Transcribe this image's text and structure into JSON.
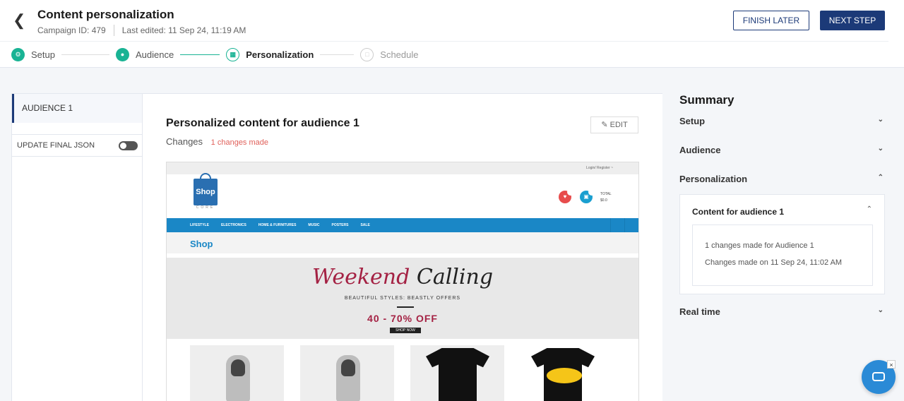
{
  "header": {
    "title": "Content personalization",
    "campaign_id": "Campaign ID: 479",
    "last_edited": "Last edited: 11 Sep 24, 11:19 AM",
    "finish_later": "FINISH LATER",
    "next_step": "NEXT STEP"
  },
  "steps": [
    {
      "label": "Setup",
      "state": "done"
    },
    {
      "label": "Audience",
      "state": "done"
    },
    {
      "label": "Personalization",
      "state": "current"
    },
    {
      "label": "Schedule",
      "state": "pending"
    }
  ],
  "sidebar": {
    "audience": "AUDIENCE 1",
    "update_json": "UPDATE FINAL JSON",
    "update_json_enabled": false
  },
  "content": {
    "title": "Personalized content for audience 1",
    "changes_label": "Changes",
    "changes_count": "1 changes made",
    "edit": "EDIT"
  },
  "preview": {
    "top_links": "Login/ Register ~",
    "logo": "Shop",
    "logo_sub": "CORE",
    "total_label": "TOTAL",
    "total_value": "$0.0",
    "nav": [
      "LIFESTYLE",
      "ELECTRONICS",
      "HOME & FURNITURES",
      "MUSIC",
      "POSTERS",
      "SALE"
    ],
    "shop_heading": "Shop",
    "banner_word1": "Weekend",
    "banner_word2": "Calling",
    "banner_tagline": "BEAUTIFUL STYLES: BEASTLY OFFERS",
    "banner_offer": "40 - 70% OFF",
    "banner_cta": "SHOP NOW"
  },
  "summary": {
    "title": "Summary",
    "setup": "Setup",
    "audience": "Audience",
    "personalization": "Personalization",
    "content_for": "Content for audience 1",
    "changes_made": "1 changes made for Audience 1",
    "changes_on": "Changes made on 11 Sep 24, 11:02 AM",
    "real_time": "Real time"
  },
  "colors": {
    "primary": "#1c3a78",
    "step_done": "#19b394",
    "changes_red": "#e0605a",
    "shop_blue": "#1a87c6",
    "banner_red": "#a42143"
  }
}
